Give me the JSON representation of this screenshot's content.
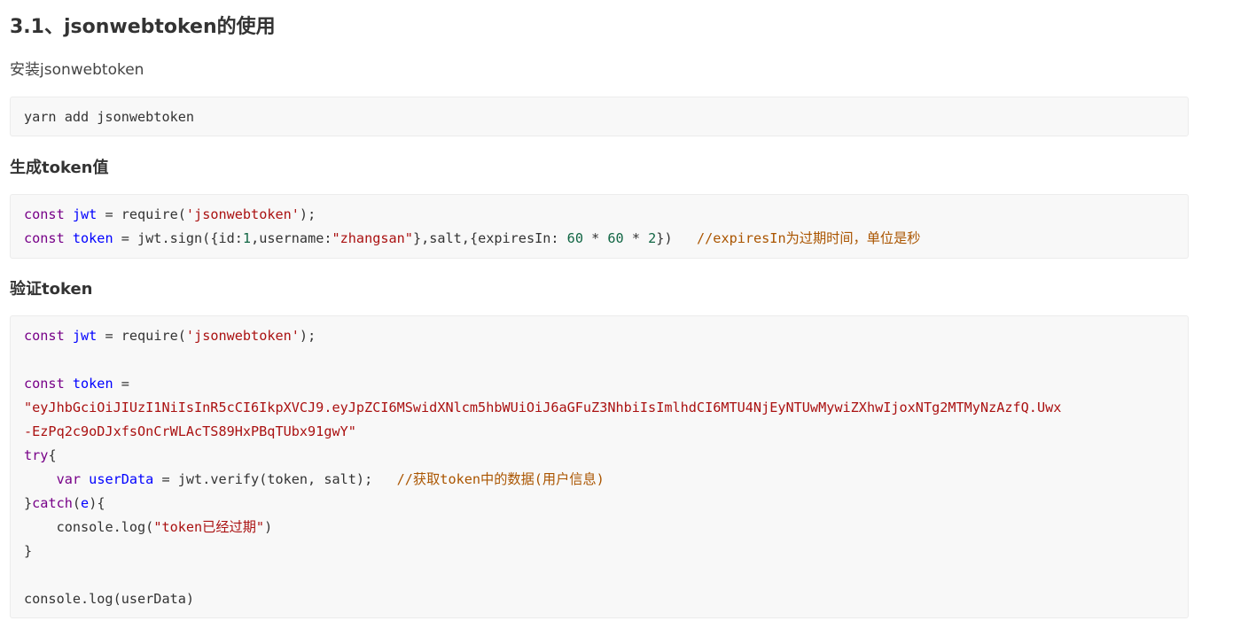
{
  "heading": "3.1、jsonwebtoken的使用",
  "install_text": "安装jsonwebtoken",
  "install_code": "yarn add jsonwebtoken",
  "generate_heading": "生成token值",
  "generate_code": {
    "line1": {
      "kw": "const",
      "var": "jwt",
      "op": " = require(",
      "str": "'jsonwebtoken'",
      "end": ");"
    },
    "line2": {
      "kw": "const",
      "var": "token",
      "a": " = jwt.sign({id:",
      "n1": "1",
      "b": ",username:",
      "s1": "\"zhangsan\"",
      "c": "},salt,{expiresIn: ",
      "n2": "60",
      "d": " * ",
      "n3": "60",
      "e": " * ",
      "n4": "2",
      "f": "})   ",
      "comment": "//expiresIn为过期时间，单位是秒"
    }
  },
  "verify_heading": "验证token",
  "verify_code": {
    "l1": {
      "kw": "const",
      "var": "jwt",
      "op": " = require(",
      "str": "'jsonwebtoken'",
      "end": ");"
    },
    "l3": {
      "kw": "const",
      "var": "token",
      "op": " ="
    },
    "l4": "\"eyJhbGciOiJIUzI1NiIsInR5cCI6IkpXVCJ9.eyJpZCI6MSwidXNlcm5hbWUiOiJ6aGFuZ3NhbiIsImlhdCI6MTU4NjEyNTUwMywiZXhwIjoxNTg2MTMyNzAzfQ.Uwx",
    "l5": "-EzPq2c9oDJxfsOnCrWLAcTS89HxPBqTUbx91gwY\"",
    "l6": {
      "kw": "try",
      "op": "{"
    },
    "l7": {
      "indent": "    ",
      "kw": "var",
      "var": "userData",
      "op": " = jwt.verify(token, salt);   ",
      "comment": "//获取token中的数据(用户信息)"
    },
    "l8": {
      "a": "}",
      "kw": "catch",
      "b": "(",
      "var": "e",
      "c": "){"
    },
    "l9": {
      "indent": "    ",
      "op": "console.log(",
      "str": "\"token已经过期\"",
      "end": ")"
    },
    "l10": "}",
    "l12": "console.log(userData)"
  }
}
